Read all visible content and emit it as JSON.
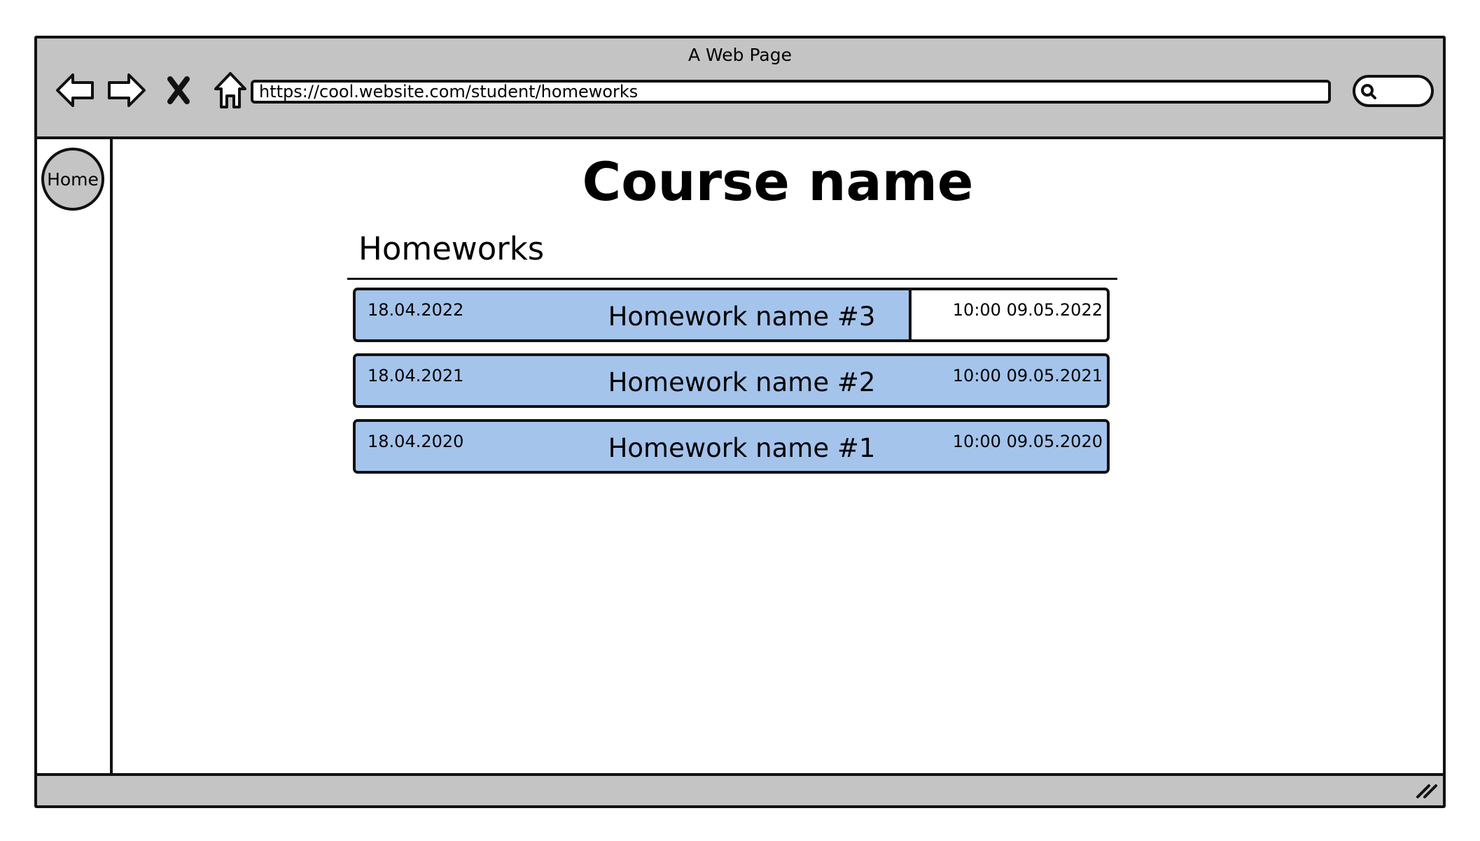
{
  "window": {
    "title": "A Web Page"
  },
  "browser": {
    "url": "https://cool.website.com/student/homeworks",
    "nav_icons": [
      "back-arrow-icon",
      "forward-arrow-icon",
      "stop-icon",
      "home-icon"
    ],
    "search_icon": "search-icon"
  },
  "sidebar": {
    "home_label": "Home"
  },
  "main": {
    "course_title": "Course name",
    "section_heading": "Homeworks",
    "homeworks": [
      {
        "start_date": "18.04.2022",
        "name": "Homework name #3",
        "due": "10:00 09.05.2022",
        "progress_fraction": 0.74
      },
      {
        "start_date": "18.04.2021",
        "name": "Homework name #2",
        "due": "10:00 09.05.2021",
        "progress_fraction": 1.0
      },
      {
        "start_date": "18.04.2020",
        "name": "Homework name #1",
        "due": "10:00 09.05.2020",
        "progress_fraction": 1.0
      }
    ]
  },
  "colors": {
    "chrome": "#c4c4c4",
    "progress_fill": "#a4c4ec",
    "outline": "#111111"
  }
}
